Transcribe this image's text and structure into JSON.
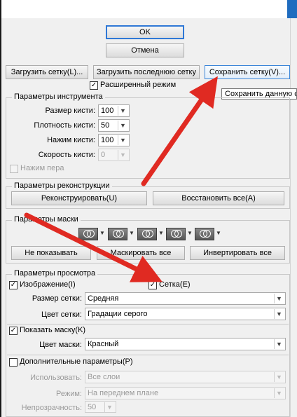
{
  "dialog": {
    "ok_label": "OK",
    "cancel_label": "Отмена"
  },
  "mesh_buttons": {
    "load": "Загрузить сетку(L)...",
    "load_last": "Загрузить последнюю сетку",
    "save": "Сохранить сетку(V)..."
  },
  "advanced_mode": {
    "label": "Расширенный режим",
    "checked": true
  },
  "tooltip": "Сохранить данную сетку",
  "tool_options": {
    "legend": "Параметры инструмента",
    "brush_size": {
      "label": "Размер кисти:",
      "value": "100"
    },
    "brush_density": {
      "label": "Плотность кисти:",
      "value": "50"
    },
    "brush_pressure": {
      "label": "Нажим кисти:",
      "value": "100"
    },
    "brush_rate": {
      "label": "Скорость кисти:",
      "value": "0"
    },
    "stylus_pressure": {
      "label": "Нажим пера",
      "checked": false
    }
  },
  "reconstruct_options": {
    "legend": "Параметры реконструкции",
    "reconstruct": "Реконструировать(U)",
    "restore_all": "Восстановить все(A)"
  },
  "mask_options": {
    "legend": "Параметры маски",
    "none": "Не показывать",
    "mask_all": "Маскировать все",
    "invert_all": "Инвертировать все",
    "mode_icons": [
      "replace-selection-icon",
      "add-to-selection-icon",
      "subtract-from-selection-icon",
      "intersect-selection-icon",
      "invert-selection-icon"
    ]
  },
  "view_options": {
    "legend": "Параметры просмотра",
    "show_image": {
      "label": "Изображение(I)",
      "checked": true
    },
    "show_mesh": {
      "label": "Сетка(E)",
      "checked": true
    },
    "mesh_size": {
      "label": "Размер сетки:",
      "value": "Средняя"
    },
    "mesh_color": {
      "label": "Цвет сетки:",
      "value": "Градации серого"
    },
    "show_mask": {
      "label": "Показать маску(K)",
      "checked": true
    },
    "mask_color": {
      "label": "Цвет маски:",
      "value": "Красный"
    },
    "show_backdrop": {
      "label": "Дополнительные параметры(P)",
      "checked": false
    },
    "use": {
      "label": "Использовать:",
      "value": "Все слои"
    },
    "mode": {
      "label": "Режим:",
      "value": "На переднем плане"
    },
    "opacity": {
      "label": "Непрозрачность:",
      "value": "50"
    }
  },
  "annotation_color": "#e02a22"
}
